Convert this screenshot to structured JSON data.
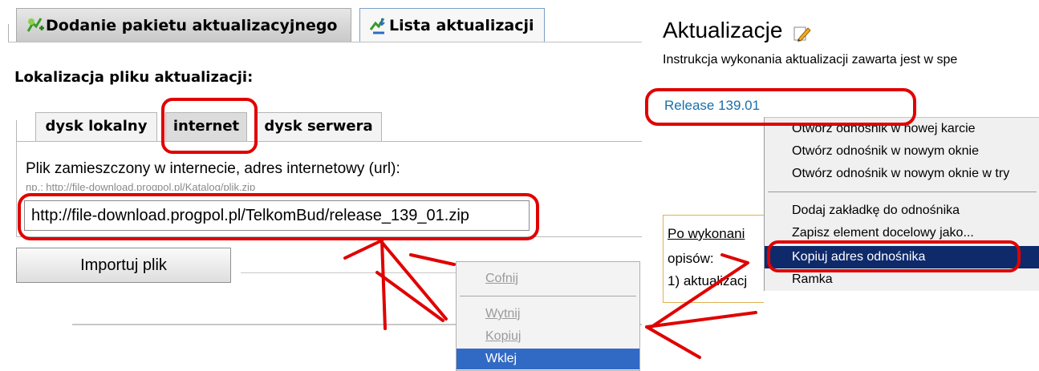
{
  "colors": {
    "annotation": "#e00000",
    "menu_highlight": "#316ac5",
    "link_menu_highlight": "#0f2a6b",
    "link": "#1a6ea8"
  },
  "top_tabs": [
    {
      "label": "Dodanie pakietu aktualizacyjnego",
      "icon": "add-package-icon"
    },
    {
      "label": "Lista aktualizacji",
      "icon": "list-download-icon"
    }
  ],
  "section_title": "Lokalizacja pliku aktualizacji:",
  "location_tabs": [
    "dysk lokalny",
    "internet",
    "dysk serwera"
  ],
  "url_label": "Plik zamieszczony w internecie, adres internetowy (url):",
  "url_example": "np.: http://file-download.progpol.pl/Katalog/plik.zip",
  "url_value": "http://file-download.progpol.pl/TelkomBud/release_139_01.zip",
  "import_button": "Importuj plik",
  "edit_menu": {
    "undo": "Cofnij",
    "cut": "Wytnij",
    "copy": "Kopiuj",
    "paste": "Wklej"
  },
  "page": {
    "title": "Aktualizacje",
    "title_icon": "edit-pencil-icon",
    "description": "Instrukcja wykonania aktualizacji zawarta jest w spe",
    "release_link": "Release 139.01",
    "behind_lines": [
      "Po wykonani",
      "opisów:",
      "1) aktualizacj"
    ]
  },
  "link_menu": {
    "items": [
      "Otwórz odnośnik w nowej karcie",
      "Otwórz odnośnik w nowym oknie",
      "Otwórz odnośnik w nowym oknie w try",
      "Dodaj zakładkę do odnośnika",
      "Zapisz element docelowy jako...",
      "Kopiuj adres odnośnika",
      "Ramka"
    ]
  }
}
